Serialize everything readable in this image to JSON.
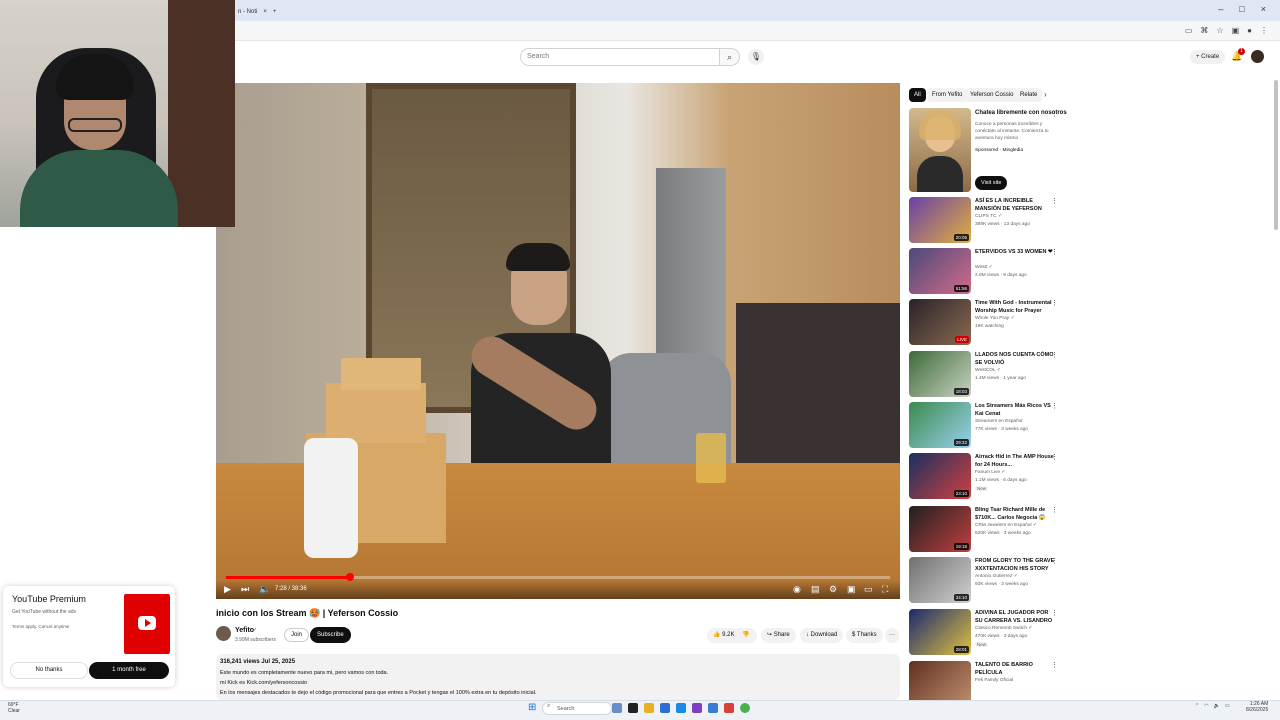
{
  "browser": {
    "tab_label": "n - Noti",
    "tab_close": "×",
    "new_tab": "+",
    "window_controls": [
      "–",
      "□",
      "×"
    ]
  },
  "topbar": {
    "search_placeholder": "Search",
    "create_label": "Create",
    "notification_count": "1"
  },
  "player": {
    "time": "7:28 / 38:36",
    "progress": 0.187
  },
  "video": {
    "title": "inicio con los Stream 🥵 | Yeferson Cossio",
    "channel": "Yefito",
    "verified": "✓",
    "subscribers": "3.99M subscribers",
    "join_label": "Join",
    "subscribe_label": "Subscribe",
    "likes": "9.2K",
    "share_label": "Share",
    "download_label": "Download",
    "thanks_label": "Thanks",
    "more_label": "···"
  },
  "description": {
    "stats": "316,241 views  Jul 25, 2025",
    "lines": [
      "Este mundo es completamente nuevo para  mi, pero vamos con toda.",
      "mi Kick es Kick.com/yefersoncossio",
      "En los mensajes destacados te dejo el código promocional para que entres a Pocket y tengas el 100% extra en tu depósito inicial."
    ]
  },
  "chips": [
    "All",
    "From Yefito",
    "Yeferson Cossio",
    "Relate"
  ],
  "ad": {
    "title": "Chatea libremente con nosotros",
    "desc": "Conoce a personas increíbles y conéctate al instante. Comienza tu aventura hoy mismo",
    "sponsor": "Sponsored · Mingledia",
    "visit_label": "Visit site"
  },
  "recommendations": [
    {
      "title": "ASÍ ES LA INCREIBLE MANSIÓN DE YEFERSON COSSIO 🏠 | ...",
      "channel": "CLIPS TC ✓",
      "meta": "389K views · 13 days ago",
      "duration": "20:05",
      "badge": ""
    },
    {
      "title": "ETERVIDOS VS 33 WOMEN ❤",
      "channel": "Westt ✓",
      "meta": "2.9M views · 9 days ago",
      "duration": "51:56",
      "badge": ""
    },
    {
      "title": "Time With God - Instrumental Worship Music for Prayer",
      "channel": "Whole You Pray ✓",
      "meta": "19K watching",
      "duration": "LIVE",
      "badge": ""
    },
    {
      "title": "LLADOS NOS CUENTA CÓMO SE VOLVIÓ MULTIMILLONARI...",
      "channel": "WestCOL ✓",
      "meta": "1.4M views · 1 year ago",
      "duration": "18:03",
      "badge": ""
    },
    {
      "title": "Los Streamers Más Ricos VS Kai Cenat",
      "channel": "Streamers en Español",
      "meta": "77K views · 3 weeks ago",
      "duration": "29:22",
      "badge": ""
    },
    {
      "title": "Airrack Hid in The AMP House for 24 Hours...",
      "channel": "Fanum Live ✓",
      "meta": "1.1M views · 6 days ago",
      "duration": "23:10",
      "badge": "New"
    },
    {
      "title": "Bling Tsar Richard Mille de $710K... Carlos Negocia 😱",
      "channel": "CRM Jewelers en Español ✓",
      "meta": "620K views · 3 weeks ago",
      "duration": "19:18",
      "badge": ""
    },
    {
      "title": "FROM GLORY TO THE GRAVE XXXTENTACION HIS STORY",
      "channel": "Antonio Gutiérrez ✓",
      "meta": "93K views · 3 weeks ago",
      "duration": "34:10",
      "badge": ""
    },
    {
      "title": "ADIVINA EL JUGADOR POR SU CARRERA VS. LISANDRO ...",
      "channel": "Clasico Rememb Switch ✓",
      "meta": "470K views · 3 days ago",
      "duration": "28:01",
      "badge": "New"
    },
    {
      "title": "TALENTO DE BARRIO PELÍCULA PUERTORRIQUEÑA",
      "channel": "Fek Family Oficial",
      "meta": "",
      "duration": "",
      "badge": ""
    }
  ],
  "premium": {
    "title": "YouTube Premium",
    "subtitle": "Get YouTube without the ads",
    "terms": "Terms apply. Cancel anytime",
    "no_thanks": "No thanks",
    "month_free": "1 month free"
  },
  "taskbar": {
    "weather_temp": "69°F",
    "weather_desc": "Clear",
    "search_label": "Search",
    "time": "1:26 AM",
    "date": "8/26/2025"
  },
  "colors": {
    "accent": "#ff0000",
    "subscribe_bg": "#0f0f0f",
    "chip_bg": "#f2f2f2",
    "premium_red": "#e00000"
  }
}
